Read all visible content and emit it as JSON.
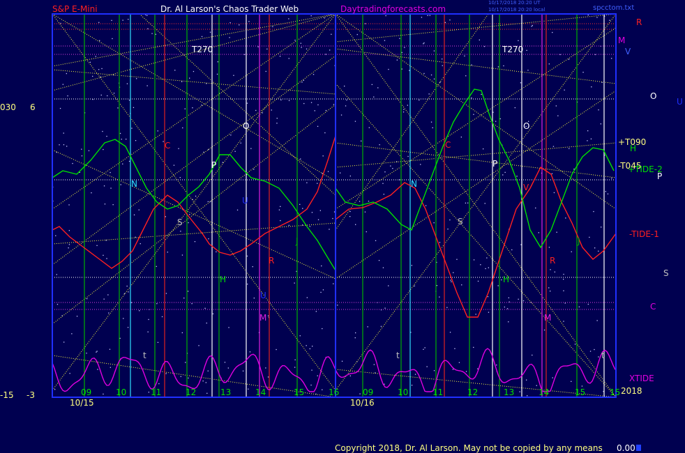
{
  "header": {
    "instrument": "S&P E-Mini",
    "author": "Dr. Al Larson's Chaos Trader Web",
    "site": "Daytradingforecasts.com",
    "stamp1": "10/17/2018 20:20 UT",
    "stamp2": "10/17/2018 20:20 local",
    "file": "spcctom.txt"
  },
  "footer": {
    "copyright": "Copyright 2018, Dr. Al Larson. May not be copied by any means",
    "value": "0.00"
  },
  "left_axis": {
    "top_a": "030",
    "top_b": "6",
    "bottom_a": "-15",
    "bottom_b": "-3"
  },
  "right_labels": {
    "R": "R",
    "M": "M",
    "V": "V",
    "O": "O",
    "U": "U",
    "T090": "+T090",
    "H": "H",
    "T045": "-T045",
    "TIDE2": "+TIDE-2",
    "P": "P",
    "TIDE1": "-TIDE-1",
    "S": "S",
    "C": "C",
    "XTIDE": "XTIDE",
    "year": "2018"
  },
  "chart_data": {
    "type": "line",
    "days": [
      "10/15",
      "10/16"
    ],
    "x_hour_ticks": [
      "09",
      "10",
      "11",
      "12",
      "13",
      "14",
      "15",
      "16"
    ],
    "x_hour_ticks_day2": [
      "09",
      "10",
      "11",
      "12",
      "13",
      "14",
      "15",
      "15"
    ],
    "in_chart_labels": {
      "T270": "T270",
      "O": "O",
      "C": "C",
      "N": "N",
      "P": "P",
      "S": "S",
      "H": "H",
      "J": "J",
      "R": "R",
      "V": "V",
      "M": "M",
      "U": "U",
      "t": "t"
    },
    "series": [
      {
        "name": "TIDE-1",
        "color": "#ff2020"
      },
      {
        "name": "TIDE-2",
        "color": "#00e000"
      },
      {
        "name": "XTIDE",
        "color": "#e000e0"
      }
    ]
  }
}
